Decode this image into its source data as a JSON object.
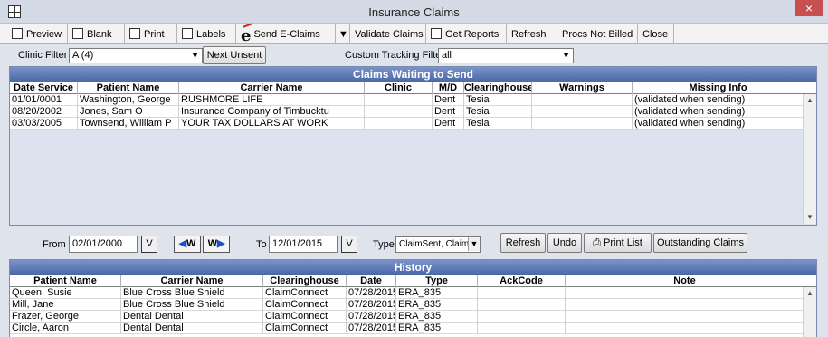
{
  "window": {
    "title": "Insurance Claims",
    "close_glyph": "×"
  },
  "toolbar": {
    "preview": "Preview",
    "blank": "Blank",
    "print": "Print",
    "labels": "Labels",
    "send_eclaims": "Send E-Claims",
    "validate_claims": "Validate Claims",
    "get_reports": "Get Reports",
    "refresh": "Refresh",
    "procs_not_billed": "Procs Not Billed",
    "close": "Close"
  },
  "filters": {
    "clinic_label": "Clinic Filter",
    "clinic_value": "A  (4)",
    "next_unsent": "Next Unsent",
    "tracking_label": "Custom Tracking Filter",
    "tracking_value": "all"
  },
  "claims": {
    "title": "Claims Waiting to Send",
    "columns": [
      "Date Service",
      "Patient Name",
      "Carrier Name",
      "Clinic",
      "M/D",
      "Clearinghouse",
      "Warnings",
      "Missing Info"
    ],
    "rows": [
      [
        "01/01/0001",
        "Washington, George",
        "RUSHMORE LIFE",
        "",
        "Dent",
        "Tesia",
        "",
        "(validated when sending)"
      ],
      [
        "08/20/2002",
        "Jones, Sam O",
        "Insurance Company of Timbucktu",
        "",
        "Dent",
        "Tesia",
        "",
        "(validated when sending)"
      ],
      [
        "03/03/2005",
        "Townsend, William P",
        "YOUR TAX DOLLARS AT WORK",
        "",
        "Dent",
        "Tesia",
        "",
        "(validated when sending)"
      ]
    ]
  },
  "history_filters": {
    "from_label": "From",
    "from_value": "02/01/2000",
    "to_label": "To",
    "to_value": "12/01/2015",
    "v_button": "V",
    "w_button": "W",
    "type_label": "Type",
    "type_value": "ClaimSent, Claim",
    "refresh": "Refresh",
    "undo": "Undo",
    "print_list": "Print List",
    "outstanding_claims": "Outstanding Claims"
  },
  "history": {
    "title": "History",
    "columns": [
      "Patient Name",
      "Carrier Name",
      "Clearinghouse",
      "Date",
      "Type",
      "AckCode",
      "Note"
    ],
    "rows": [
      [
        "Queen, Susie",
        "Blue Cross Blue Shield",
        "ClaimConnect",
        "07/28/2015",
        "ERA_835",
        "",
        ""
      ],
      [
        "Mill, Jane",
        "Blue Cross Blue Shield",
        "ClaimConnect",
        "07/28/2015",
        "ERA_835",
        "",
        ""
      ],
      [
        "Frazer, George",
        "Dental Dental",
        "ClaimConnect",
        "07/28/2015",
        "ERA_835",
        "",
        ""
      ],
      [
        "Circle, Aaron",
        "Dental Dental",
        "ClaimConnect",
        "07/28/2015",
        "ERA_835",
        "",
        ""
      ]
    ]
  }
}
